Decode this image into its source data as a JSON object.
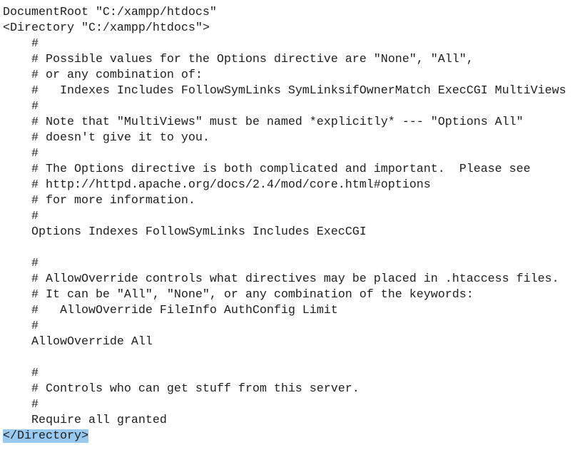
{
  "editor": {
    "partial_top_line": "#",
    "lines": [
      "DocumentRoot \"C:/xampp/htdocs\"",
      "<Directory \"C:/xampp/htdocs\">",
      "    #",
      "    # Possible values for the Options directive are \"None\", \"All\",",
      "    # or any combination of:",
      "    #   Indexes Includes FollowSymLinks SymLinksifOwnerMatch ExecCGI MultiViews",
      "    #",
      "    # Note that \"MultiViews\" must be named *explicitly* --- \"Options All\"",
      "    # doesn't give it to you.",
      "    #",
      "    # The Options directive is both complicated and important.  Please see",
      "    # http://httpd.apache.org/docs/2.4/mod/core.html#options",
      "    # for more information.",
      "    #",
      "    Options Indexes FollowSymLinks Includes ExecCGI",
      "",
      "    #",
      "    # AllowOverride controls what directives may be placed in .htaccess files.",
      "    # It can be \"All\", \"None\", or any combination of the keywords:",
      "    #   AllowOverride FileInfo AuthConfig Limit",
      "    #",
      "    AllowOverride All",
      "",
      "    #",
      "    # Controls who can get stuff from this server.",
      "    #",
      "    Require all granted",
      "</Directory>"
    ],
    "selected_line_index": 27,
    "selection_color": "#99c9ef"
  }
}
